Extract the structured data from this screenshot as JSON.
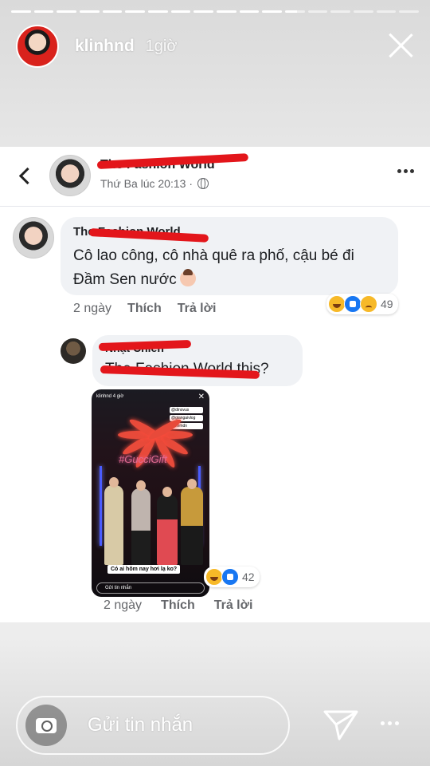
{
  "story": {
    "username": "klinhnd",
    "posted_ago": "1giờ",
    "segments_total": 18,
    "segments_done": 12
  },
  "post": {
    "page_name": "The Fashion World",
    "meta_time": "Thứ Ba lúc 20:13 ·"
  },
  "comment1": {
    "author": "The Fashion World",
    "text": "Cô lao công, cô nhà quê ra phố, cậu bé đi Đầm Sen nước",
    "time": "2 ngày",
    "like_label": "Thích",
    "reply_label": "Trả lời",
    "reaction_count": "49",
    "reaction_icons": [
      "haha-icon",
      "like-icon",
      "sad-icon"
    ]
  },
  "comment2": {
    "author": "Nhật Chiến",
    "mention": "The Fashion World",
    "text_suffix": "this?",
    "time": "2 ngày",
    "like_label": "Thích",
    "reply_label": "Trả lời",
    "reaction_count": "42",
    "reaction_icons": [
      "haha-icon",
      "like-icon"
    ],
    "attachment": {
      "top_user": "klinhnd",
      "top_time": "4 giờ",
      "tags": [
        "@dinovus",
        "@giangaivlog",
        "@kemdn"
      ],
      "neon_text": "#GucciGift",
      "caption": "Có ai hôm nay hơi lạ ko?",
      "bottom_placeholder": "Gửi tin nhắn"
    }
  },
  "composer": {
    "placeholder": "Gửi tin nhắn"
  },
  "colors": {
    "accent_red_scribble": "#e3161b",
    "fb_blue": "#1877f2",
    "bubble_gray": "#f0f2f5"
  }
}
